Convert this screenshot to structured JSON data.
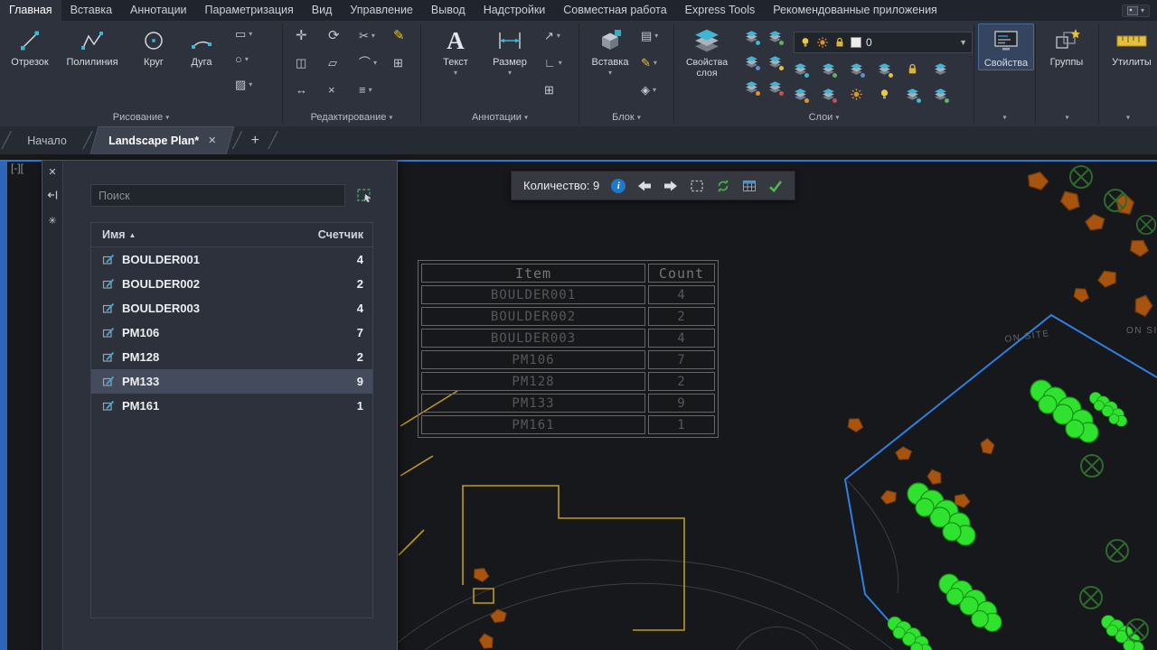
{
  "ribbon": {
    "tabs": [
      "Главная",
      "Вставка",
      "Аннотации",
      "Параметризация",
      "Вид",
      "Управление",
      "Вывод",
      "Надстройки",
      "Совместная работа",
      "Express Tools",
      "Рекомендованные приложения"
    ],
    "active_tab": "Главная",
    "panels": {
      "draw": {
        "label": "Рисование",
        "line": "Отрезок",
        "polyline": "Полилиния",
        "circle": "Круг",
        "arc": "Дуга"
      },
      "modify": {
        "label": "Редактирование"
      },
      "annotation": {
        "label": "Аннотации",
        "text": "Текст",
        "dimension": "Размер"
      },
      "block": {
        "label": "Блок",
        "insert": "Вставка"
      },
      "layers": {
        "label": "Слои",
        "layer_properties": "Свойства слоя",
        "current_layer": "0"
      },
      "properties": {
        "label": "Свойства"
      },
      "groups": {
        "label": "Группы"
      },
      "utilities": {
        "label": "Утилиты"
      }
    }
  },
  "file_tabs": {
    "home": "Начало",
    "drawing": "Landscape Plan*"
  },
  "palette": {
    "search_placeholder": "Поиск",
    "columns": {
      "name": "Имя",
      "count": "Счетчик"
    },
    "selected": "PM133",
    "rows": [
      {
        "name": "BOULDER001",
        "count": "4"
      },
      {
        "name": "BOULDER002",
        "count": "2"
      },
      {
        "name": "BOULDER003",
        "count": "4"
      },
      {
        "name": "PM106",
        "count": "7"
      },
      {
        "name": "PM128",
        "count": "2"
      },
      {
        "name": "PM133",
        "count": "9"
      },
      {
        "name": "PM161",
        "count": "1"
      }
    ]
  },
  "count_toolbar": {
    "count_label": "Количество: 9"
  },
  "canvas": {
    "viewport_controls": "[-][",
    "site_label": "ON SITE",
    "table": {
      "headers": [
        "Item",
        "Count"
      ],
      "rows": [
        [
          "BOULDER001",
          "4"
        ],
        [
          "BOULDER002",
          "2"
        ],
        [
          "BOULDER003",
          "4"
        ],
        [
          "PM106",
          "7"
        ],
        [
          "PM128",
          "2"
        ],
        [
          "PM133",
          "9"
        ],
        [
          "PM161",
          "1"
        ]
      ]
    }
  },
  "colors": {
    "accent_blue": "#2f7fe0",
    "shrub_green": "#2ee22e",
    "boundary_yellow": "#c09a20",
    "boulder_orange": "#a8540e"
  }
}
